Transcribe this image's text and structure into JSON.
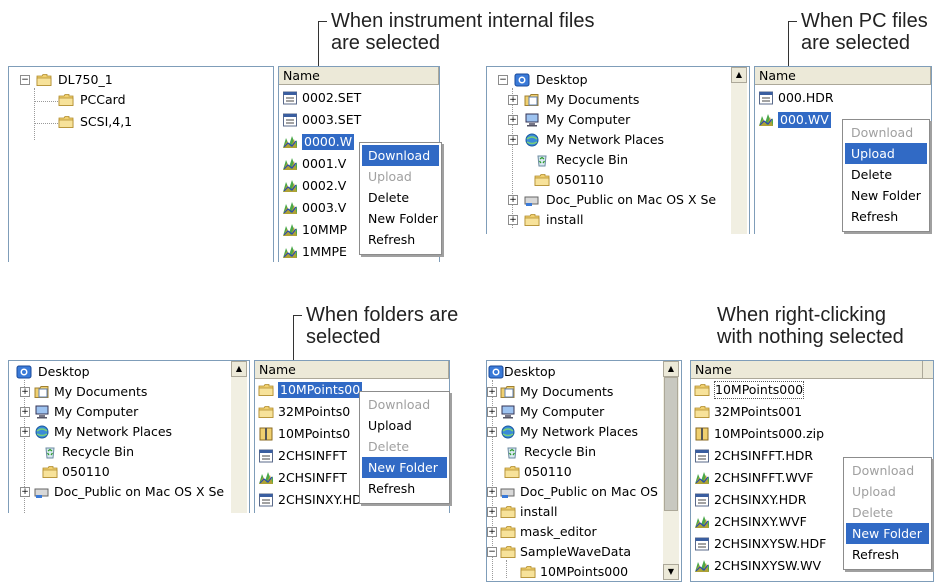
{
  "captions": {
    "top_left": [
      "When instrument internal files",
      "are selected"
    ],
    "top_right": [
      "When PC files",
      "are selected"
    ],
    "bottom_left": [
      "When folders are",
      "selected"
    ],
    "bottom_right": [
      "When right-clicking",
      "with nothing selected"
    ]
  },
  "common": {
    "name_header": "Name",
    "desktop": "Desktop",
    "my_documents": "My Documents",
    "my_computer": "My Computer",
    "my_network_places": "My Network Places",
    "recycle_bin": "Recycle Bin",
    "folder_050110": "050110"
  },
  "panel1": {
    "tree": [
      "DL750_1",
      "PCCard",
      "SCSI,4,1"
    ],
    "files": [
      "0002.SET",
      "0003.SET",
      "0000.W",
      "0001.V",
      "0002.V",
      "0003.V",
      "10MMP",
      "1MMPE"
    ],
    "menu": [
      "Download",
      "Upload",
      "Delete",
      "New Folder",
      "Refresh"
    ]
  },
  "panel2": {
    "doc_public": "Doc_Public on Mac OS X Se",
    "install": "install",
    "files": [
      "000.HDR",
      "000.WV"
    ],
    "menu": [
      "Download",
      "Upload",
      "Delete",
      "New Folder",
      "Refresh"
    ]
  },
  "panel3": {
    "doc_public": "Doc_Public on Mac OS X Se",
    "files": [
      "10MPoints00",
      "32MPoints0",
      "10MPoints0",
      "2CHSINFFT",
      "2CHSINFFT",
      "2CHSINXY.HDR"
    ],
    "menu": [
      "Download",
      "Upload",
      "Delete",
      "New Folder",
      "Refresh"
    ]
  },
  "panel4": {
    "doc_public": "Doc_Public on Mac OS",
    "tree_extra": [
      "install",
      "mask_editor",
      "SampleWaveData",
      "10MPoints000"
    ],
    "files": [
      "10MPoints000",
      "32MPoints001",
      "10MPoints000.zip",
      "2CHSINFFT.HDR",
      "2CHSINFFT.WVF",
      "2CHSINXY.HDR",
      "2CHSINXY.WVF",
      "2CHSINXYSW.HDF",
      "2CHSINXYSW.WV"
    ],
    "menu": [
      "Download",
      "Upload",
      "Delete",
      "New Folder",
      "Refresh"
    ]
  }
}
